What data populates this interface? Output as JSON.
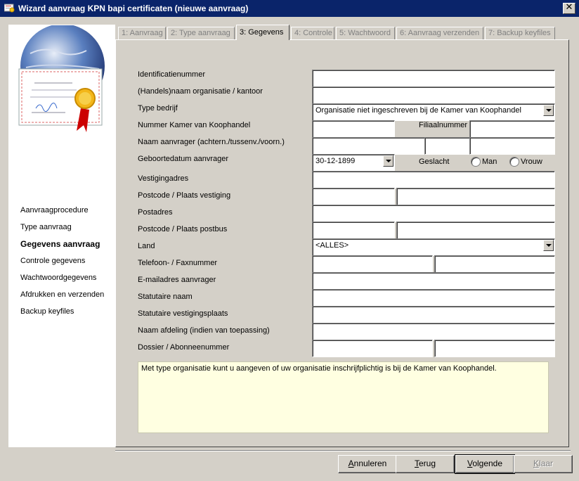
{
  "window": {
    "title": "Wizard aanvraag KPN bapi certificaten (nieuwe aanvraag)",
    "close_label": "✕"
  },
  "sidebar": {
    "items": [
      {
        "label": "Aanvraagprocedure",
        "active": false
      },
      {
        "label": "Type aanvraag",
        "active": false
      },
      {
        "label": "Gegevens aanvraag",
        "active": true
      },
      {
        "label": "Controle gegevens",
        "active": false
      },
      {
        "label": "Wachtwoordgegevens",
        "active": false
      },
      {
        "label": "Afdrukken en verzenden",
        "active": false
      },
      {
        "label": "Backup keyfiles",
        "active": false
      }
    ]
  },
  "tabs": [
    {
      "label": "1: Aanvraag"
    },
    {
      "label": "2: Type aanvraag"
    },
    {
      "label": "3: Gegevens"
    },
    {
      "label": "4: Controle"
    },
    {
      "label": "5: Wachtwoord"
    },
    {
      "label": "6: Aanvraag verzenden"
    },
    {
      "label": "7: Backup keyfiles"
    }
  ],
  "active_tab": 2,
  "form": {
    "identificatienummer": {
      "label": "Identificatienummer",
      "value": ""
    },
    "handelsnaam": {
      "label": "(Handels)naam organisatie / kantoor",
      "value": ""
    },
    "type_bedrijf": {
      "label": "Type bedrijf",
      "value": "Organisatie niet ingeschreven bij de Kamer van Koophandel"
    },
    "kvk": {
      "label": "Nummer Kamer van Koophandel",
      "value": ""
    },
    "filiaal": {
      "label": "Filiaalnummer",
      "value": ""
    },
    "naam": {
      "label": "Naam aanvrager (achtern./tussenv./voorn.)",
      "achternaam": "",
      "tussenvoegsel": "",
      "voornaam": ""
    },
    "geboortedatum": {
      "label": "Geboortedatum aanvrager",
      "value": "30-12-1899"
    },
    "geslacht": {
      "label": "Geslacht",
      "man": "Man",
      "vrouw": "Vrouw"
    },
    "vestigingsadres": {
      "label": "Vestigingadres",
      "value": ""
    },
    "postcode_vestiging": {
      "label": "Postcode / Plaats vestiging",
      "postcode": "",
      "plaats": ""
    },
    "postadres": {
      "label": "Postadres",
      "value": ""
    },
    "postcode_postbus": {
      "label": "Postcode / Plaats postbus",
      "postcode": "",
      "plaats": ""
    },
    "land": {
      "label": "Land",
      "value": "<ALLES>"
    },
    "telefoon": {
      "label": "Telefoon- / Faxnummer",
      "telefoon": "",
      "fax": ""
    },
    "email": {
      "label": "E-mailadres aanvrager",
      "value": ""
    },
    "statutaire_naam": {
      "label": "Statutaire naam",
      "value": ""
    },
    "statutaire_plaats": {
      "label": "Statutaire vestigingsplaats",
      "value": ""
    },
    "afdeling": {
      "label": "Naam afdeling (indien van toepassing)",
      "value": ""
    },
    "dossier": {
      "label": "Dossier / Abonneenummer",
      "dossier": "",
      "abonnee": ""
    }
  },
  "help_text": "Met type organisatie kunt u aangeven of uw organisatie inschrijfplichtig is bij de Kamer van Koophandel.",
  "buttons": {
    "annuleren": {
      "prefix": "",
      "mnemonic": "A",
      "rest": "nnuleren"
    },
    "terug": {
      "prefix": "",
      "mnemonic": "T",
      "rest": "erug"
    },
    "volgende": {
      "prefix": "",
      "mnemonic": "V",
      "rest": "olgende"
    },
    "klaar": {
      "prefix": "",
      "mnemonic": "K",
      "rest": "laar"
    }
  },
  "icons": {
    "logo": "certificate-globe-icon",
    "app": "certificate-app-icon"
  }
}
